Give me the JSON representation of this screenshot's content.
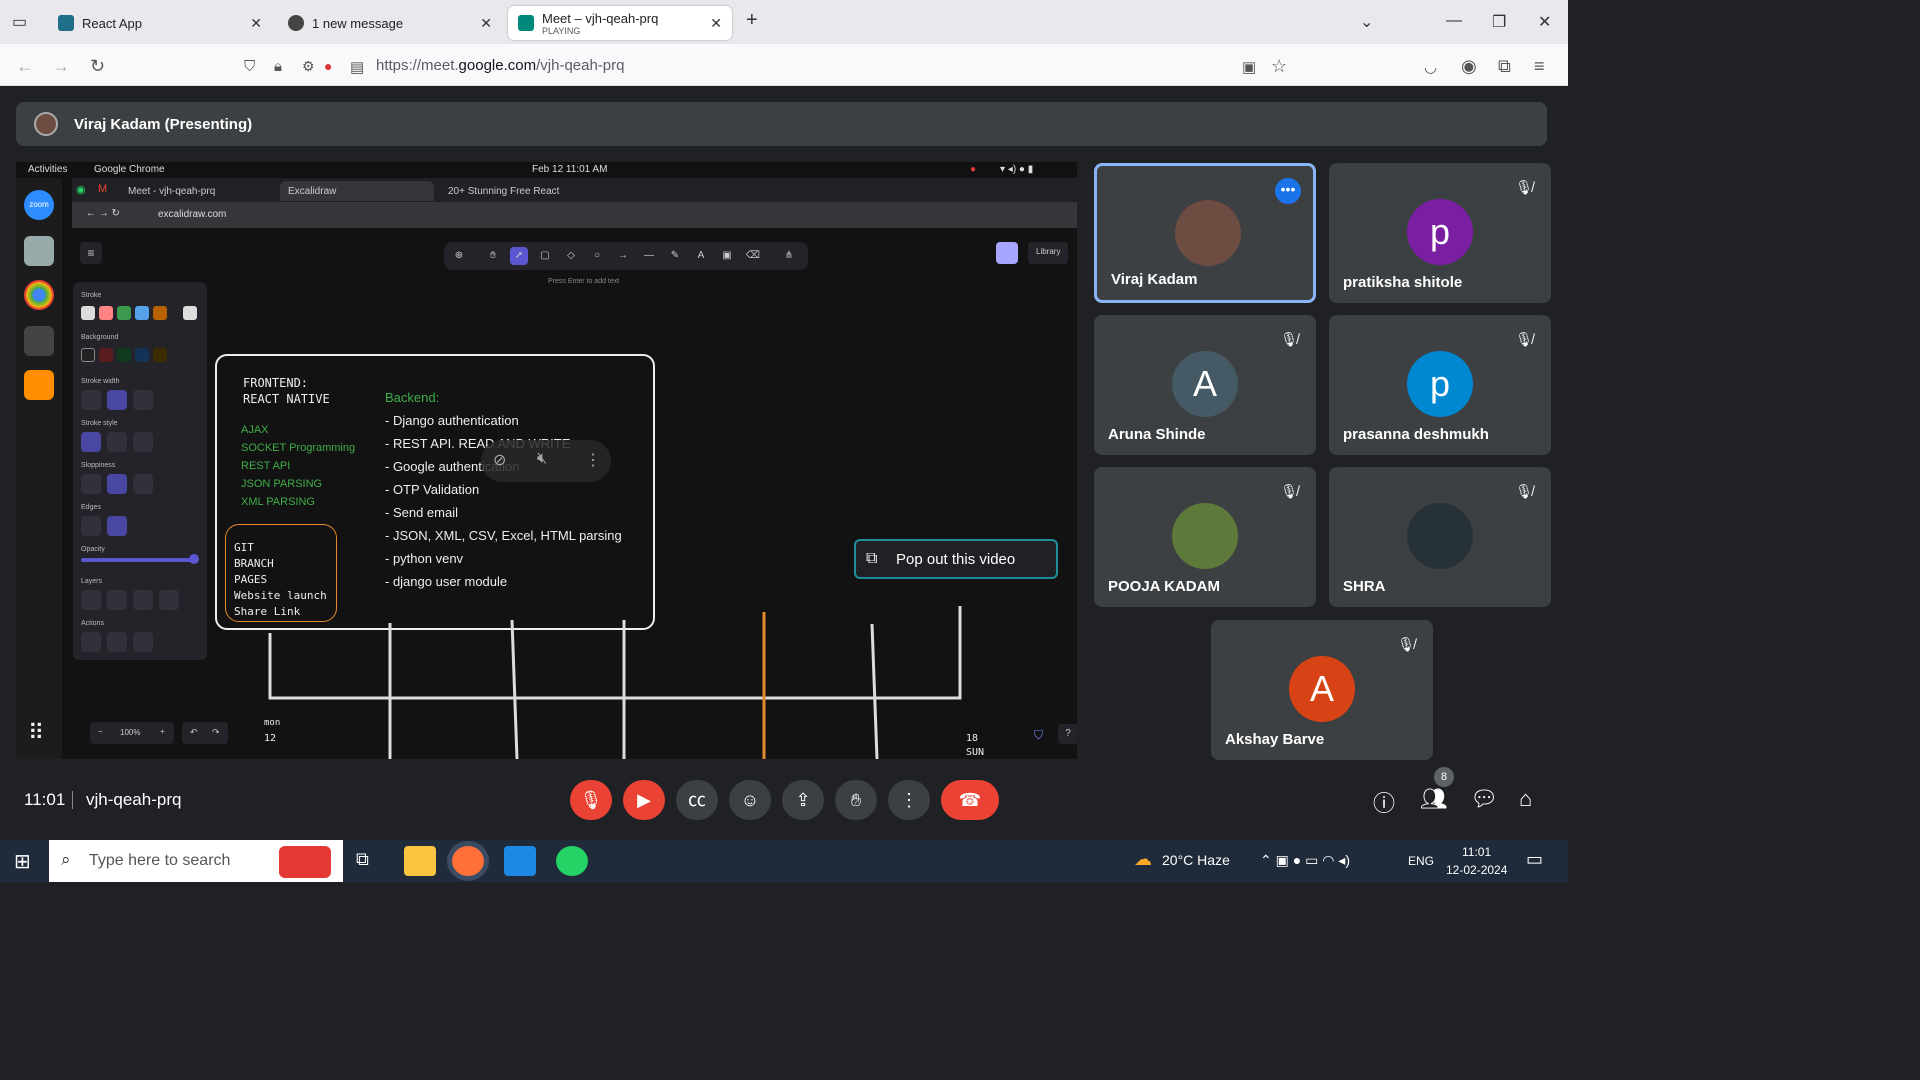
{
  "browser": {
    "tabs": [
      {
        "title": "React App",
        "color": "#1f6f8b"
      },
      {
        "title": "1 new message",
        "color": "#444"
      },
      {
        "title": "Meet – vjh-qeah-prq",
        "subtitle": "PLAYING",
        "color": "#00897b"
      }
    ],
    "url_prefix": "https://meet.",
    "url_domain": "google.com",
    "url_path": "/vjh-qeah-prq"
  },
  "meet": {
    "presenter_label": "Viraj Kadam (Presenting)",
    "clock": "11:01",
    "meeting_code": "vjh-qeah-prq",
    "participant_count": "8",
    "popout_label": "Pop out this video"
  },
  "shared_screen": {
    "gnome_activities": "Activities",
    "gnome_app": "Google Chrome",
    "gnome_datetime": "Feb 12  11:01 AM",
    "inner_tabs": [
      "Meet - vjh-qeah-prq",
      "Excalidraw",
      "20+ Stunning Free React"
    ],
    "inner_url": "excalidraw.com",
    "hint": "Press Enter to add text",
    "library_label": "Library",
    "zoom_level": "100%",
    "panel": {
      "stroke": "Stroke",
      "background": "Background",
      "stroke_width": "Stroke width",
      "stroke_style": "Stroke style",
      "sloppiness": "Sloppiness",
      "edges": "Edges",
      "opacity": "Opacity",
      "layers": "Layers",
      "actions": "Actions"
    },
    "frontend_title": "FRONTEND:",
    "frontend_sub": "REACT NATIVE",
    "frontend_items": [
      "AJAX",
      "SOCKET Programming",
      "REST API",
      "JSON PARSING",
      "XML PARSING"
    ],
    "git_items": [
      "GIT",
      "BRANCH",
      "PAGES",
      "Website launch",
      "Share Link"
    ],
    "backend_title": "Backend:",
    "backend_items": [
      "- Django authentication",
      "- REST API. READ AND WRITE",
      "- Google authentication",
      "- OTP Validation",
      "- Send email",
      "- JSON, XML, CSV, Excel, HTML parsing",
      "- python venv",
      "- django user module"
    ],
    "calendar_mon": "mon",
    "calendar_12": "12",
    "calendar_18": "18",
    "calendar_sun": "SUN"
  },
  "participants": [
    {
      "name": "Viraj Kadam",
      "initial": "",
      "color": "#6d4c41",
      "active": true
    },
    {
      "name": "pratiksha shitole",
      "initial": "p",
      "color": "#7b1fa2"
    },
    {
      "name": "Aruna Shinde",
      "initial": "A",
      "color": "#455a64"
    },
    {
      "name": "prasanna deshmukh",
      "initial": "p",
      "color": "#0288d1"
    },
    {
      "name": "POOJA KADAM",
      "initial": "",
      "color": "#5d7a3a"
    },
    {
      "name": "SHRA",
      "initial": "",
      "color": "#263238"
    },
    {
      "name": "Akshay Barve",
      "initial": "A",
      "color": "#d84315"
    }
  ],
  "taskbar": {
    "search_placeholder": "Type here to search",
    "weather": "20°C  Haze",
    "lang": "ENG",
    "time": "11:01",
    "date": "12-02-2024"
  }
}
